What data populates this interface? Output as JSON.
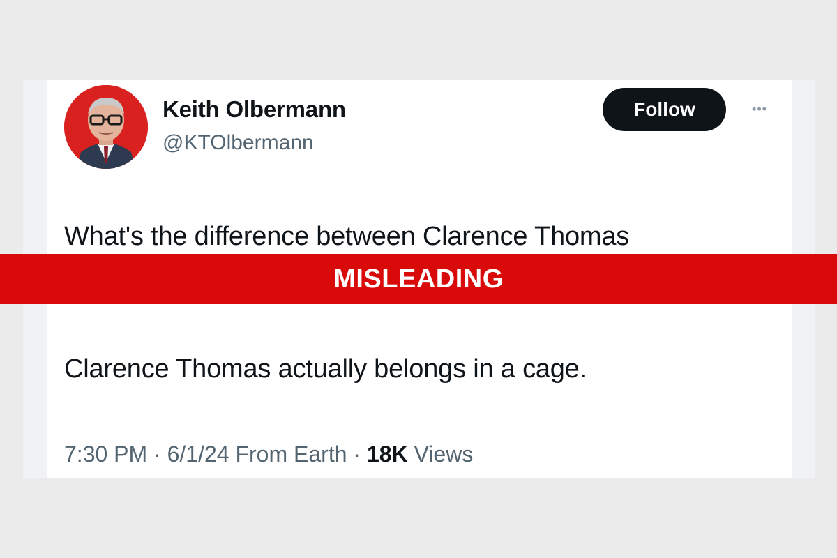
{
  "tweet": {
    "author": {
      "name": "Keith Olbermann",
      "handle": "@KTOlbermann"
    },
    "follow_label": "Follow",
    "more_icon": "more-dots-icon",
    "text_lines": [
      "What's the difference between Clarence Thomas",
      "Clarence Thomas actually belongs in a cage."
    ],
    "meta": {
      "time": "7:30 PM",
      "separator": "·",
      "date_source": "6/1/24 From Earth",
      "views_count": "18K",
      "views_label": "Views"
    }
  },
  "banner": {
    "label": "MISLEADING"
  },
  "colors": {
    "banner": "#d90a0a",
    "follow_button": "#0f1419",
    "avatar_background": "#d9211f"
  }
}
